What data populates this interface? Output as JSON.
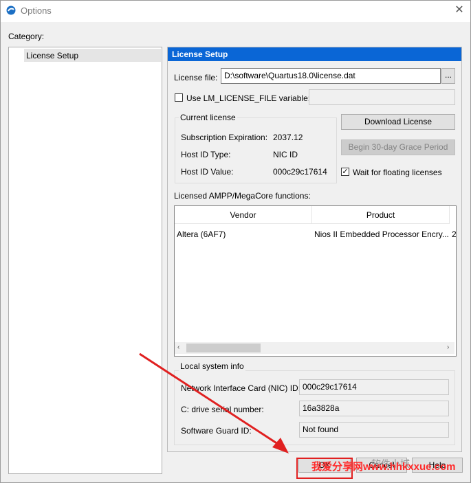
{
  "window": {
    "title": "Options",
    "close_symbol": "✕"
  },
  "category": {
    "label": "Category:",
    "items": [
      {
        "label": "License Setup",
        "selected": true
      }
    ]
  },
  "panel": {
    "header": "License Setup",
    "license_file": {
      "label": "License file:",
      "value": "D:\\software\\Quartus18.0\\license.dat",
      "browse_label": "..."
    },
    "lm_license_var": {
      "label": "Use LM_LICENSE_FILE variable:",
      "checked": false,
      "value": ""
    },
    "current_license": {
      "title": "Current license",
      "rows": [
        {
          "label": "Subscription Expiration:",
          "value": "2037.12"
        },
        {
          "label": "Host ID Type:",
          "value": "NIC ID"
        },
        {
          "label": "Host ID Value:",
          "value": "000c29c17614"
        }
      ]
    },
    "download_license_label": "Download License",
    "grace_period_label": "Begin 30-day Grace Period",
    "wait_floating": {
      "label": "Wait for floating licenses",
      "checked": true
    },
    "ampp_label": "Licensed AMPP/MegaCore functions:",
    "table": {
      "columns": [
        "Vendor",
        "Product"
      ],
      "rows": [
        {
          "vendor": "Altera (6AF7)",
          "product": "Nios II Embedded Processor Encry...",
          "extra": "2"
        }
      ]
    },
    "local_info": {
      "title": "Local system info",
      "rows": [
        {
          "label": "Network Interface Card (NIC) ID:",
          "value": "000c29c17614"
        },
        {
          "label": "C: drive serial number:",
          "value": "16a3828a"
        },
        {
          "label": "Software Guard ID:",
          "value": "Not found"
        }
      ]
    }
  },
  "buttons": {
    "ok": "OK",
    "cancel": "Cancel",
    "help": "Help"
  },
  "watermark": {
    "red": "我爱分享网www.hhkxxue.com",
    "gray": "软件小城"
  },
  "colors": {
    "header": "#0a66d6",
    "annotation": "#e02020"
  }
}
